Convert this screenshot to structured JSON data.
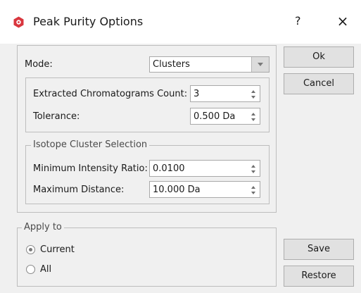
{
  "window": {
    "title": "Peak Purity Options",
    "help_glyph": "?",
    "close_glyph": "×"
  },
  "mode": {
    "label": "Mode:",
    "value": "Clusters"
  },
  "extracted": {
    "count_label": "Extracted Chromatograms Count:",
    "count_value": "3",
    "tolerance_label": "Tolerance:",
    "tolerance_value": "0.500 Da"
  },
  "isotope": {
    "legend": "Isotope Cluster Selection",
    "ratio_label": "Minimum Intensity Ratio:",
    "ratio_value": "0.0100",
    "distance_label": "Maximum Distance:",
    "distance_value": "10.000 Da"
  },
  "apply_to": {
    "legend": "Apply to",
    "options": [
      {
        "label": "Current",
        "checked": true
      },
      {
        "label": "All",
        "checked": false
      }
    ]
  },
  "buttons": {
    "ok": "Ok",
    "cancel": "Cancel",
    "save": "Save",
    "restore": "Restore"
  },
  "colors": {
    "app_icon": "#d9363e",
    "background": "#f0f0f0"
  }
}
